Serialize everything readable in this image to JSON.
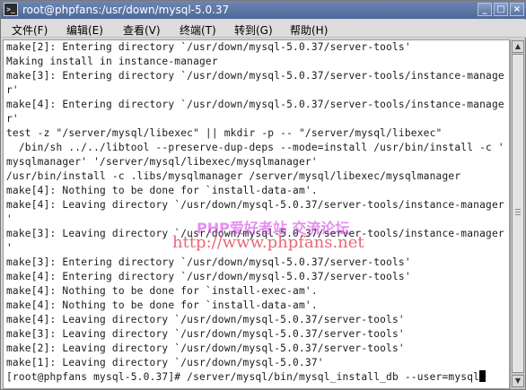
{
  "window": {
    "title": "root@phpfans:/usr/down/mysql-5.0.37",
    "title_icon": "terminal-icon",
    "controls": {
      "minimize": "_",
      "maximize": "□",
      "close": "×"
    }
  },
  "menubar": {
    "items": [
      {
        "label": "文件(F)"
      },
      {
        "label": "编辑(E)"
      },
      {
        "label": "查看(V)"
      },
      {
        "label": "终端(T)"
      },
      {
        "label": "转到(G)"
      },
      {
        "label": "帮助(H)"
      }
    ]
  },
  "terminal": {
    "lines": [
      "make[2]: Entering directory `/usr/down/mysql-5.0.37/server-tools'",
      "Making install in instance-manager",
      "make[3]: Entering directory `/usr/down/mysql-5.0.37/server-tools/instance-manage",
      "r'",
      "make[4]: Entering directory `/usr/down/mysql-5.0.37/server-tools/instance-manage",
      "r'",
      "test -z \"/server/mysql/libexec\" || mkdir -p -- \"/server/mysql/libexec\"",
      "  /bin/sh ../../libtool --preserve-dup-deps --mode=install /usr/bin/install -c '",
      "mysqlmanager' '/server/mysql/libexec/mysqlmanager'",
      "/usr/bin/install -c .libs/mysqlmanager /server/mysql/libexec/mysqlmanager",
      "make[4]: Nothing to be done for `install-data-am'.",
      "make[4]: Leaving directory `/usr/down/mysql-5.0.37/server-tools/instance-manager",
      "'",
      "make[3]: Leaving directory `/usr/down/mysql-5.0.37/server-tools/instance-manager",
      "'",
      "make[3]: Entering directory `/usr/down/mysql-5.0.37/server-tools'",
      "make[4]: Entering directory `/usr/down/mysql-5.0.37/server-tools'",
      "make[4]: Nothing to be done for `install-exec-am'.",
      "make[4]: Nothing to be done for `install-data-am'.",
      "make[4]: Leaving directory `/usr/down/mysql-5.0.37/server-tools'",
      "make[3]: Leaving directory `/usr/down/mysql-5.0.37/server-tools'",
      "make[2]: Leaving directory `/usr/down/mysql-5.0.37/server-tools'",
      "make[1]: Leaving directory `/usr/down/mysql-5.0.37'"
    ],
    "prompt": "[root@phpfans mysql-5.0.37]# /server/mysql/bin/mysql_install_db --user=mysql",
    "watermark_cn": "PHP爱好者站  交流论坛",
    "watermark_url": "http://www.phpfans.net"
  }
}
